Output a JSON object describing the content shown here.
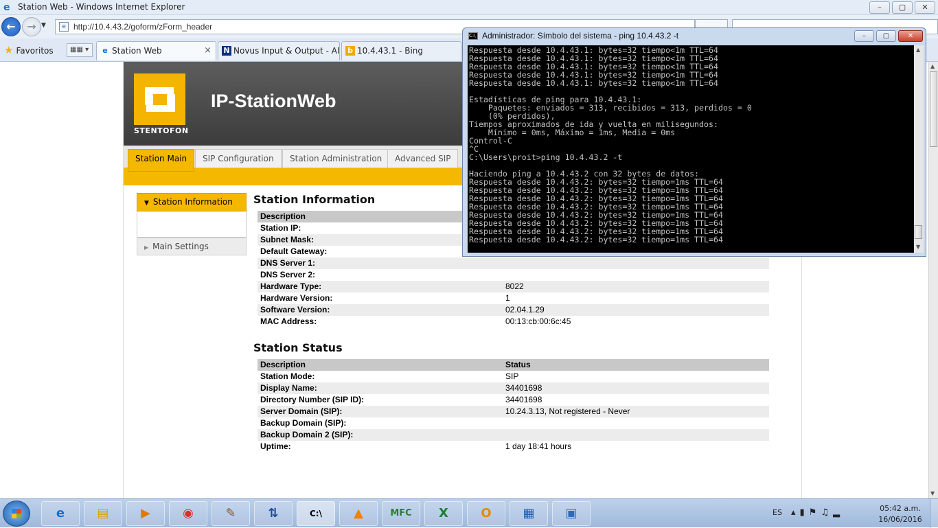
{
  "browser": {
    "title": "Station Web - Windows Internet Explorer",
    "url": "http://10.4.43.2/goform/zForm_header",
    "favorites_label": "Favoritos",
    "tabs": [
      {
        "label": "Station Web",
        "active": true,
        "close": "×"
      },
      {
        "label": "Novus Input & Output - Al...",
        "active": false
      },
      {
        "label": "10.4.43.1 - Bing",
        "active": false
      }
    ],
    "window_buttons": {
      "minimize": "–",
      "maximize": "▢",
      "close": "✕"
    }
  },
  "site": {
    "logo_text": "STENTOFON",
    "brand": "IP-StationWeb",
    "nav_tabs": [
      "Station Main",
      "SIP Configuration",
      "Station Administration",
      "Advanced SIP"
    ],
    "left_menu": {
      "active": "Station Information",
      "items": [
        "Main Settings"
      ]
    }
  },
  "station_information": {
    "title": "Station Information",
    "header": "Description",
    "rows": [
      {
        "label": "Station IP:",
        "value": ""
      },
      {
        "label": "Subnet Mask:",
        "value": ""
      },
      {
        "label": "Default Gateway:",
        "value": ""
      },
      {
        "label": "DNS Server 1:",
        "value": ""
      },
      {
        "label": "DNS Server 2:",
        "value": ""
      },
      {
        "label": "Hardware Type:",
        "value": "8022"
      },
      {
        "label": "Hardware Version:",
        "value": "1"
      },
      {
        "label": "Software Version:",
        "value": "02.04.1.29"
      },
      {
        "label": "MAC Address:",
        "value": "00:13:cb:00:6c:45"
      }
    ]
  },
  "station_status": {
    "title": "Station Status",
    "header": [
      "Description",
      "Status"
    ],
    "rows": [
      {
        "label": "Station Mode:",
        "value": "SIP"
      },
      {
        "label": "Display Name:",
        "value": "34401698"
      },
      {
        "label": "Directory Number (SIP ID):",
        "value": "34401698"
      },
      {
        "label": "Server Domain (SIP):",
        "value": "10.24.3.13, Not registered - Never"
      },
      {
        "label": "Backup Domain (SIP):",
        "value": ""
      },
      {
        "label": "Backup Domain 2 (SIP):",
        "value": ""
      },
      {
        "label": "Uptime:",
        "value": "1 day 18:41 hours"
      }
    ]
  },
  "cmd": {
    "title": "Administrador: Símbolo del sistema - ping  10.4.43.2 -t",
    "icon_text": "C:\\",
    "output": "Respuesta desde 10.4.43.1: bytes=32 tiempo<1m TTL=64\nRespuesta desde 10.4.43.1: bytes=32 tiempo<1m TTL=64\nRespuesta desde 10.4.43.1: bytes=32 tiempo<1m TTL=64\nRespuesta desde 10.4.43.1: bytes=32 tiempo<1m TTL=64\nRespuesta desde 10.4.43.1: bytes=32 tiempo<1m TTL=64\n\nEstadísticas de ping para 10.4.43.1:\n    Paquetes: enviados = 313, recibidos = 313, perdidos = 0\n    (0% perdidos),\nTiempos aproximados de ida y vuelta en milisegundos:\n    Mínimo = 0ms, Máximo = 1ms, Media = 0ms\nControl-C\n^C\nC:\\Users\\proit>ping 10.4.43.2 -t\n\nHaciendo ping a 10.4.43.2 con 32 bytes de datos:\nRespuesta desde 10.4.43.2: bytes=32 tiempo=1ms TTL=64\nRespuesta desde 10.4.43.2: bytes=32 tiempo=1ms TTL=64\nRespuesta desde 10.4.43.2: bytes=32 tiempo=1ms TTL=64\nRespuesta desde 10.4.43.2: bytes=32 tiempo=1ms TTL=64\nRespuesta desde 10.4.43.2: bytes=32 tiempo=1ms TTL=64\nRespuesta desde 10.4.43.2: bytes=32 tiempo=1ms TTL=64\nRespuesta desde 10.4.43.2: bytes=32 tiempo=1ms TTL=64\nRespuesta desde 10.4.43.2: bytes=32 tiempo=1ms TTL=64"
  },
  "taskbar": {
    "apps": [
      "internet-explorer-icon",
      "file-explorer-icon",
      "media-player-icon",
      "chrome-icon",
      "paint-icon",
      "network-tool-icon",
      "command-prompt-icon",
      "vlc-icon",
      "mfc-app-icon",
      "excel-icon",
      "outlook-icon",
      "control-panel-icon",
      "picture-viewer-icon"
    ],
    "language": "ES",
    "time": "05:42 a.m.",
    "date": "16/06/2016"
  },
  "colors": {
    "accent": "#f5b800",
    "header_bg": "#4a4a4a",
    "cmd_bg": "#000000"
  }
}
